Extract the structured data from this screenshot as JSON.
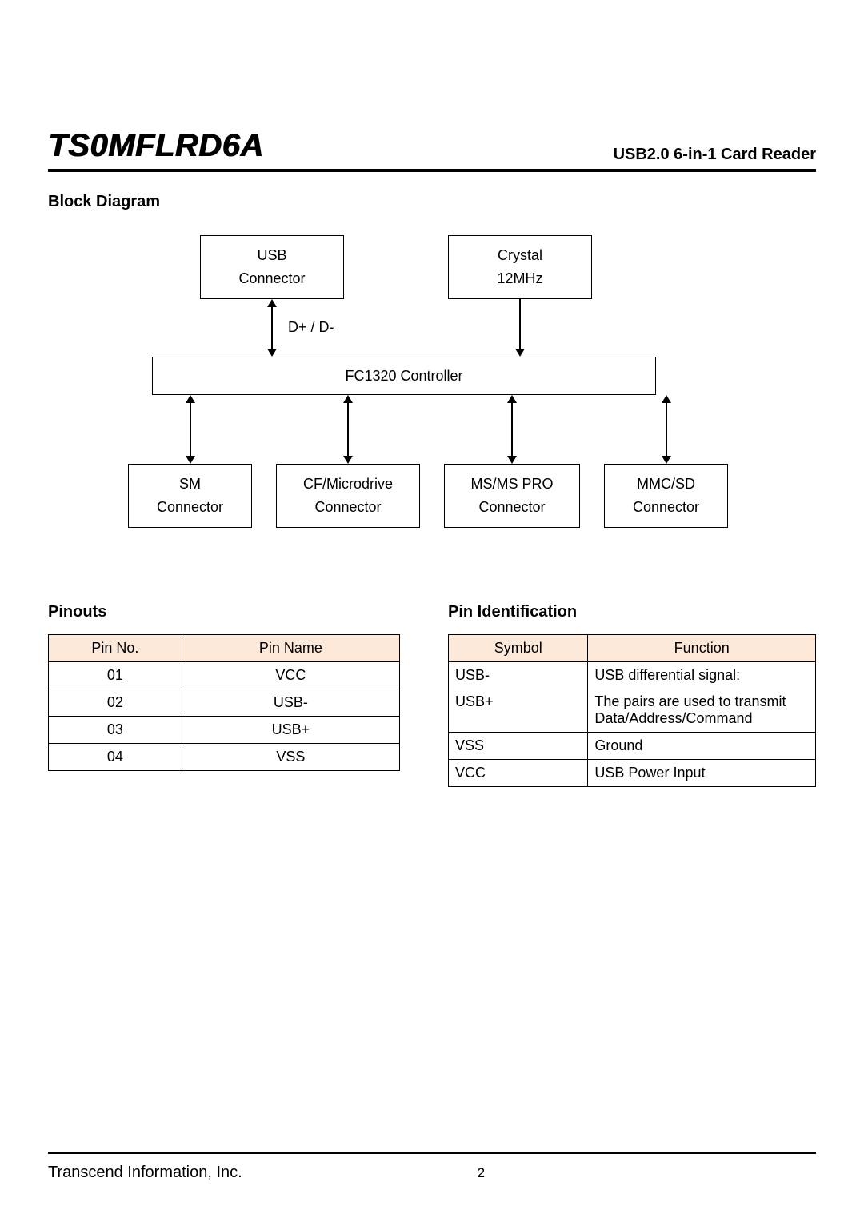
{
  "header": {
    "part_no": "TS0MFLRD6A",
    "subtitle": "USB2.0 6-in-1 Card Reader"
  },
  "sections": {
    "block_diagram": "Block Diagram",
    "pinouts": "Pinouts",
    "pin_identification": "Pin Identification"
  },
  "diagram": {
    "usb_connector_l1": "USB",
    "usb_connector_l2": "Connector",
    "crystal_l1": "Crystal",
    "crystal_l2": "12MHz",
    "dplus_dminus": "D+ / D-",
    "controller": "FC1320 Controller",
    "sm_l1": "SM",
    "sm_l2": "Connector",
    "cf_l1": "CF/Microdrive",
    "cf_l2": "Connector",
    "ms_l1": "MS/MS PRO",
    "ms_l2": "Connector",
    "mmc_l1": "MMC/SD",
    "mmc_l2": "Connector"
  },
  "pinouts_table": {
    "head_pin_no": "Pin No.",
    "head_pin_name": "Pin Name",
    "rows": [
      {
        "no": "01",
        "name": "VCC"
      },
      {
        "no": "02",
        "name": "USB-"
      },
      {
        "no": "03",
        "name": "USB+"
      },
      {
        "no": "04",
        "name": "VSS"
      }
    ]
  },
  "pin_id_table": {
    "head_symbol": "Symbol",
    "head_function": "Function",
    "rows": [
      {
        "symbol": "USB-",
        "function": "USB differential signal:"
      },
      {
        "symbol": "USB+",
        "function": "The pairs are used to transmit Data/Address/Command"
      },
      {
        "symbol": "VSS",
        "function": "Ground"
      },
      {
        "symbol": "VCC",
        "function": "USB Power Input"
      }
    ]
  },
  "footer": {
    "company": "Transcend Information, Inc.",
    "page": "2"
  }
}
